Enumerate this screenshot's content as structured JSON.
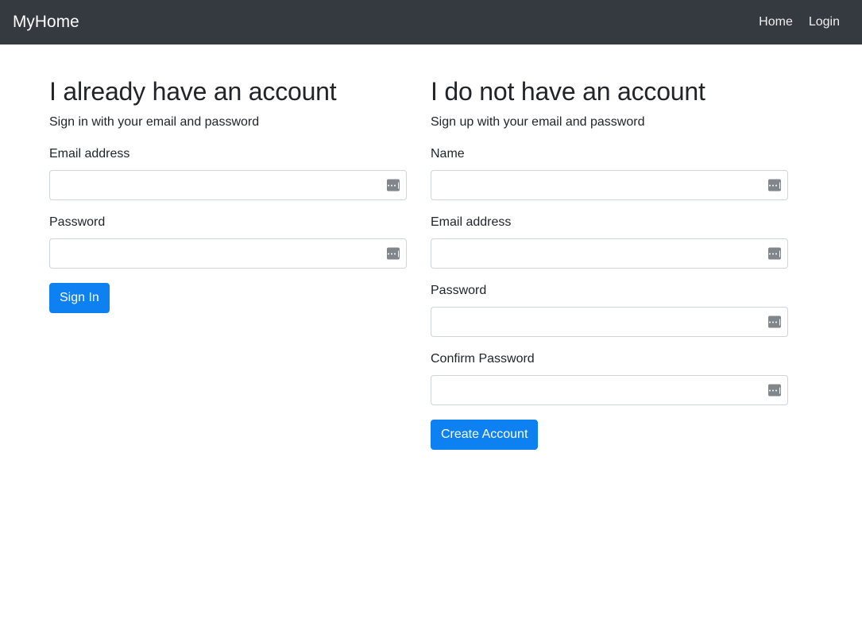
{
  "navbar": {
    "brand": "MyHome",
    "links": [
      {
        "label": "Home",
        "name": "nav-link-home"
      },
      {
        "label": "Login",
        "name": "nav-link-login"
      }
    ]
  },
  "signin": {
    "title": "I already have an account",
    "subtitle": "Sign in with your email and password",
    "fields": [
      {
        "label": "Email address",
        "value": "",
        "placeholder": ""
      },
      {
        "label": "Password",
        "value": "",
        "placeholder": ""
      }
    ],
    "submit_label": "Sign In"
  },
  "signup": {
    "title": "I do not have an account",
    "subtitle": "Sign up with your email and password",
    "fields": [
      {
        "label": "Name",
        "value": "",
        "placeholder": ""
      },
      {
        "label": "Email address",
        "value": "",
        "placeholder": ""
      },
      {
        "label": "Password",
        "value": "",
        "placeholder": ""
      },
      {
        "label": "Confirm Password",
        "value": "",
        "placeholder": ""
      }
    ],
    "submit_label": "Create Account"
  },
  "icons": {
    "field_badge": "autofill-dots-icon"
  },
  "colors": {
    "navbar_bg": "#343a40",
    "primary": "#0d80f2",
    "text": "#212529",
    "input_border": "#ced4da",
    "badge_gray": "#80868b"
  }
}
